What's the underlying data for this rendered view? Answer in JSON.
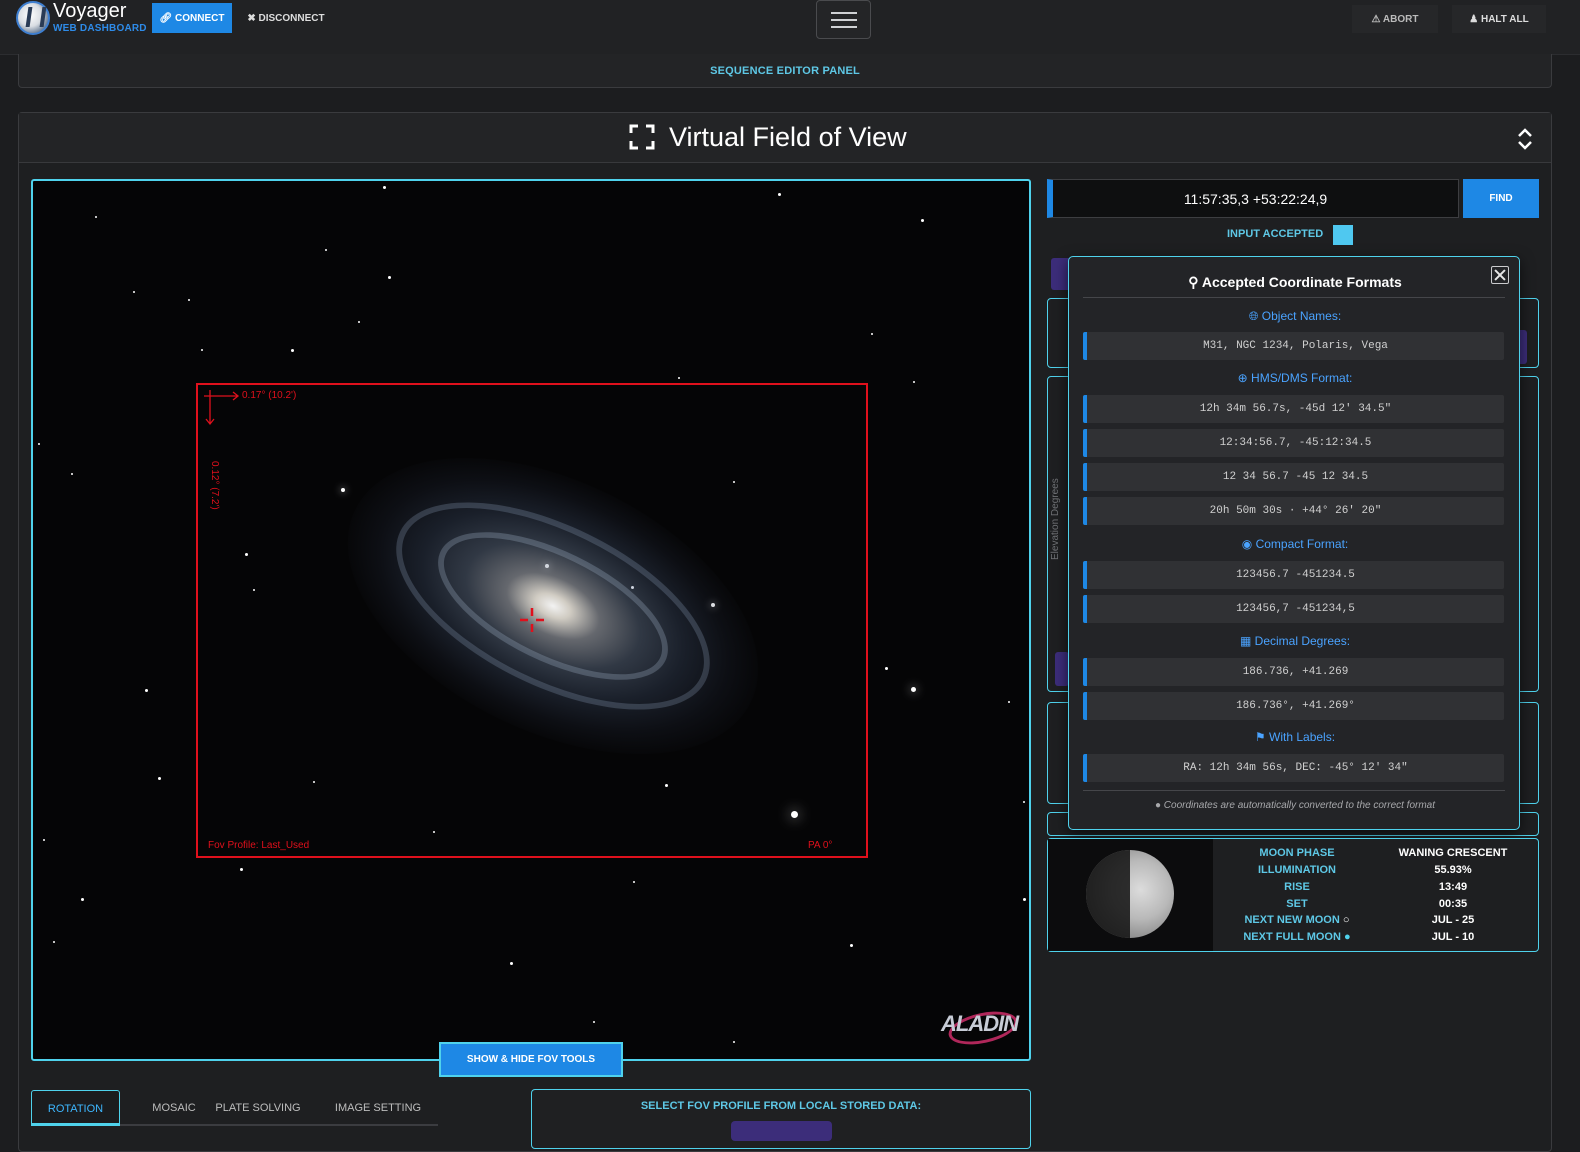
{
  "header": {
    "app_title": "Voyager",
    "app_subtitle": "WEB DASHBOARD",
    "connect_label": "CONNECT",
    "disconnect_label": "DISCONNECT",
    "abort_label": "ABORT",
    "halt_label": "HALT ALL"
  },
  "sequence_panel": {
    "label": "SEQUENCE EDITOR PANEL"
  },
  "vfov": {
    "title": "Virtual Field of View",
    "fov_width_label": "0.17° (10.2')",
    "fov_height_label": "0.12° (7.2')",
    "fov_profile_label": "Fov Profile: Last_Used",
    "pa_label": "PA 0°",
    "aladin_label": "ALADIN",
    "show_hide_tools": "SHOW & HIDE FOV TOOLS",
    "tabs": [
      "ROTATION",
      "MOSAIC",
      "PLATE SOLVING",
      "IMAGE SETTING"
    ],
    "profile_select_label": "SELECT FOV PROFILE FROM LOCAL STORED DATA:"
  },
  "search": {
    "value": "11:57:35,3 +53:22:24,9",
    "find_label": "FIND",
    "status": "INPUT ACCEPTED",
    "status_color": "#4fc8f0"
  },
  "elevation_axis_label": "Elevation Degrees",
  "formats_popup": {
    "title": "Accepted Coordinate Formats",
    "sections": [
      {
        "heading": "Object Names:",
        "icon": "globe-icon",
        "examples": [
          "M31, NGC 1234, Polaris, Vega"
        ]
      },
      {
        "heading": "HMS/DMS Format:",
        "icon": "crosshair-icon",
        "examples": [
          "12h 34m 56.7s, -45d 12' 34.5\"",
          "12:34:56.7, -45:12:34.5",
          "12 34 56.7 -45 12 34.5",
          "20h 50m 30s · +44° 26' 20\""
        ]
      },
      {
        "heading": "Compact Format:",
        "icon": "compass-icon",
        "examples": [
          "123456.7 -451234.5",
          "123456,7 -451234,5"
        ]
      },
      {
        "heading": "Decimal Degrees:",
        "icon": "calculator-icon",
        "examples": [
          "186.736, +41.269",
          "186.736°, +41.269°"
        ]
      },
      {
        "heading": "With Labels:",
        "icon": "tags-icon",
        "examples": [
          "RA: 12h 34m 56s, DEC: -45° 12' 34\""
        ]
      }
    ],
    "footer": "Coordinates are automatically converted to the correct format"
  },
  "moon": {
    "rows": [
      {
        "key": "MOON PHASE",
        "value": "WANING CRESCENT"
      },
      {
        "key": "ILLUMINATION",
        "value": "55.93%"
      },
      {
        "key": "RISE",
        "value": "13:49"
      },
      {
        "key": "SET",
        "value": "00:35"
      },
      {
        "key": "NEXT NEW MOON",
        "value": "JUL - 25"
      },
      {
        "key": "NEXT FULL MOON",
        "value": "JUL - 10"
      }
    ]
  },
  "colors": {
    "accent": "#1e88e5",
    "cyan": "#4fd2ec",
    "fov_red": "#e0101c"
  }
}
